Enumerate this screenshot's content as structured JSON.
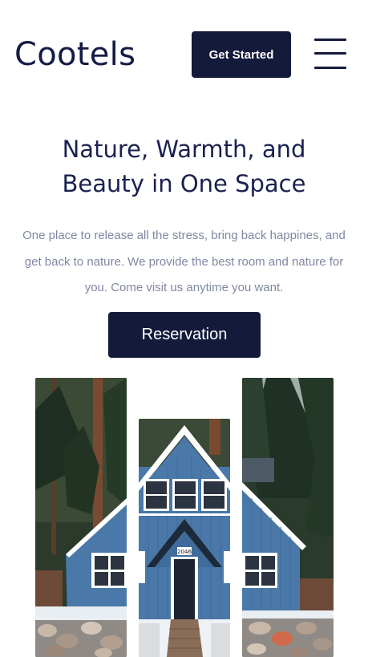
{
  "header": {
    "logo": "Cootels",
    "cta_label": "Get Started",
    "menu_icon": "hamburger-menu-icon"
  },
  "hero": {
    "title_line1": "Nature, Warmth, and",
    "title_line2": "Beauty in One Space",
    "description": "One place to release all the stress, bring back happines, and get back to nature. We provide the best room and nature for you. Come visit us anytime you want.",
    "cta_label": "Reservation"
  },
  "gallery": {
    "house_number": "2046"
  },
  "colors": {
    "navy": "#131a3a",
    "title": "#1a2150",
    "text_muted": "#8087a2",
    "house_blue": "#4a78a8"
  }
}
